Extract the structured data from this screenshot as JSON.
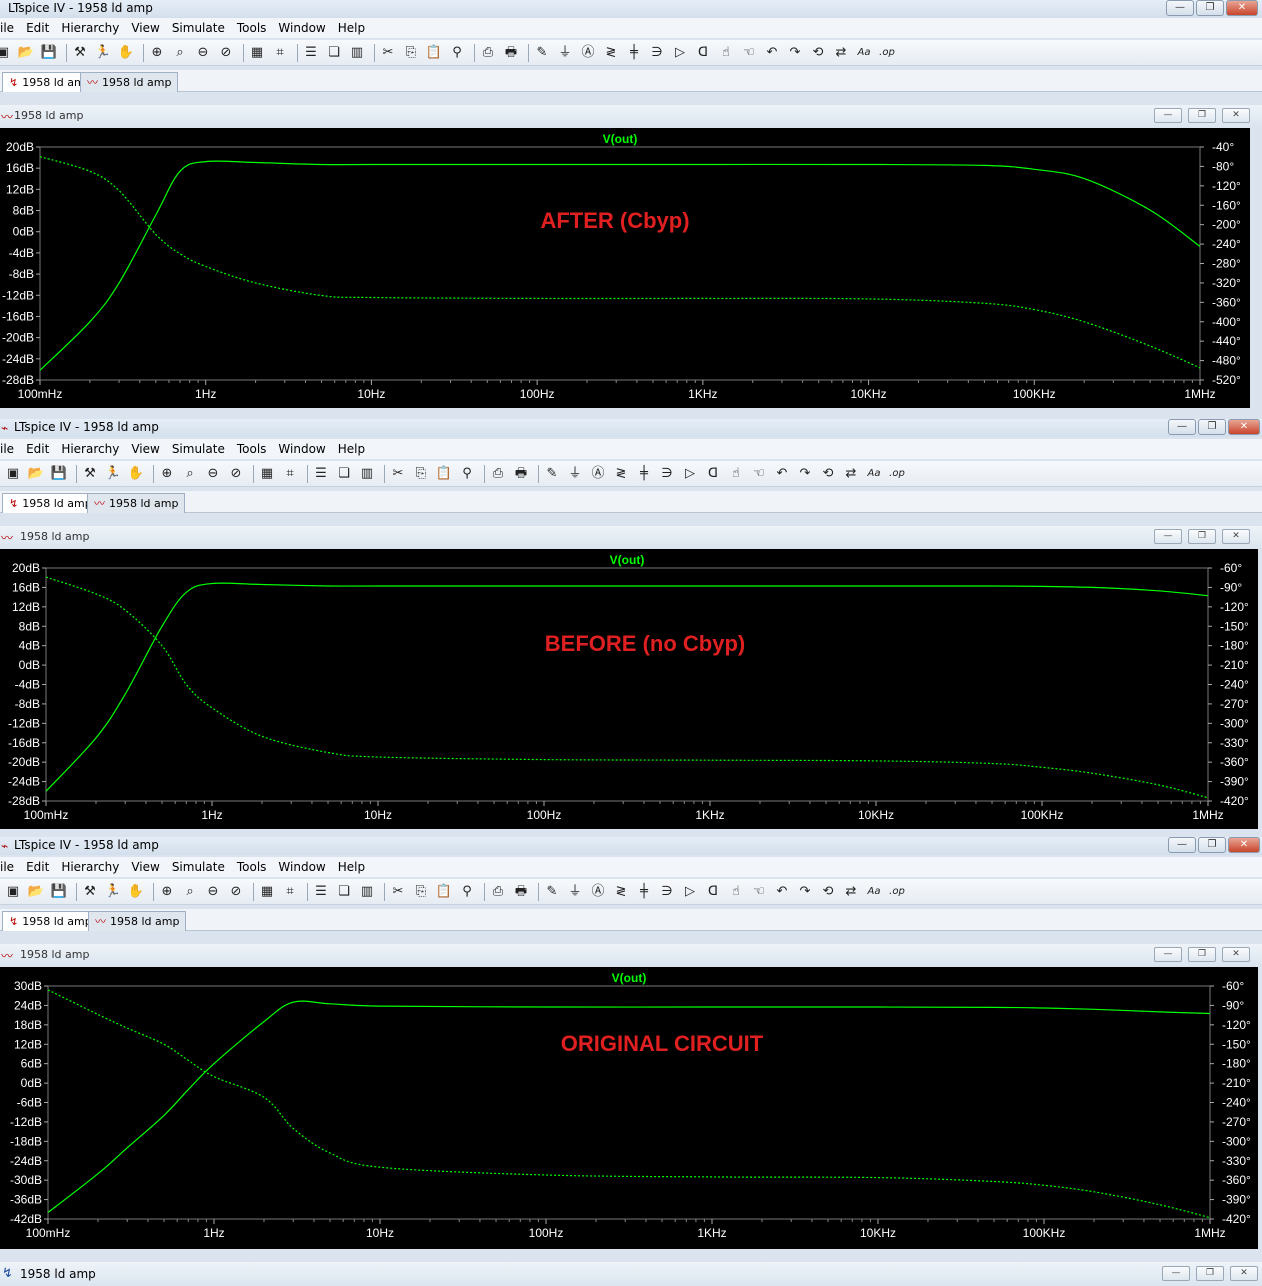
{
  "app_title": "LTspice IV - 1958 ld amp",
  "menu": [
    "ile",
    "Edit",
    "Hierarchy",
    "View",
    "Simulate",
    "Tools",
    "Window",
    "Help"
  ],
  "tabs": [
    {
      "label": "1958 ld amp"
    },
    {
      "label": "1958 ld amp"
    }
  ],
  "window_title": "1958 ld amp",
  "trace_name": "V(out)",
  "x_ticks": [
    "100mHz",
    "1Hz",
    "10Hz",
    "100Hz",
    "1KHz",
    "10KHz",
    "100KHz",
    "1MHz"
  ],
  "colors": {
    "trace": "#00ff00",
    "annotation": "#e02020",
    "axis_text": "#ffffff",
    "plot_bg": "#000000"
  },
  "bottom_title": "1958 ld amp",
  "toolbar_icons": [
    "new-schematic-icon",
    "open-icon",
    "save-icon",
    "hammer-icon",
    "run-icon",
    "hand-icon",
    "zoom-in-icon",
    "zoom-area-icon",
    "zoom-out-icon",
    "zoom-cancel-icon",
    "autorange-icon",
    "grid-icon",
    "tile-h-icon",
    "cascade-icon",
    "tile-v-icon",
    "cut-icon",
    "copy-icon",
    "paste-icon",
    "find-icon",
    "print-setup-icon",
    "print-icon",
    "wire-icon",
    "ground-icon",
    "label-icon",
    "resistor-icon",
    "capacitor-icon",
    "inductor-icon",
    "diode-icon",
    "component-icon",
    "move-icon",
    "drag-icon",
    "undo-icon",
    "redo-icon",
    "rotate-icon",
    "mirror-icon",
    "text-icon",
    "spice-directive-icon"
  ],
  "chart_data": [
    {
      "type": "line",
      "annotation": "AFTER  (Cbyp)",
      "x_axis": "log frequency",
      "x": [
        "100mHz",
        "200mHz",
        "300mHz",
        "500mHz",
        "700mHz",
        "1Hz",
        "2Hz",
        "5Hz",
        "10Hz",
        "100Hz",
        "1KHz",
        "10KHz",
        "50KHz",
        "100KHz",
        "200KHz",
        "500KHz",
        "1MHz"
      ],
      "yleft_ticks": [
        "20dB",
        "16dB",
        "12dB",
        "8dB",
        "0dB",
        "-4dB",
        "-8dB",
        "-12dB",
        "-16dB",
        "-20dB",
        "-24dB",
        "-28dB"
      ],
      "yright_ticks": [
        "-40°",
        "-80°",
        "-120°",
        "-160°",
        "-200°",
        "-240°",
        "-280°",
        "-320°",
        "-360°",
        "-400°",
        "-440°",
        "-480°",
        "-520°"
      ],
      "ylim_left": [
        -28,
        20
      ],
      "ylim_right": [
        -520,
        -40
      ],
      "series": [
        {
          "values": [
            -26,
            -16,
            -8,
            6,
            15,
            17,
            16.8,
            16.4,
            16.4,
            16.4,
            16.4,
            16.4,
            16.2,
            15.4,
            13.5,
            7,
            -0.5
          ],
          "style": "solid"
        },
        {
          "values": [
            -60,
            -90,
            -130,
            -220,
            -260,
            -286,
            -320,
            -346,
            -350,
            -352,
            -352,
            -353,
            -362,
            -375,
            -400,
            -450,
            -495
          ],
          "style": "dotted"
        }
      ]
    },
    {
      "type": "line",
      "annotation": "BEFORE (no Cbyp)",
      "x_axis": "log frequency",
      "x": [
        "100mHz",
        "200mHz",
        "300mHz",
        "500mHz",
        "700mHz",
        "1Hz",
        "2Hz",
        "5Hz",
        "10Hz",
        "100Hz",
        "1KHz",
        "10KHz",
        "50KHz",
        "100KHz",
        "200KHz",
        "500KHz",
        "1MHz"
      ],
      "yleft_ticks": [
        "20dB",
        "16dB",
        "12dB",
        "8dB",
        "4dB",
        "0dB",
        "-4dB",
        "-8dB",
        "-12dB",
        "-16dB",
        "-20dB",
        "-24dB",
        "-28dB"
      ],
      "yright_ticks": [
        "-60°",
        "-90°",
        "-120°",
        "-150°",
        "-180°",
        "-210°",
        "-240°",
        "-270°",
        "-300°",
        "-330°",
        "-360°",
        "-390°",
        "-420°"
      ],
      "ylim_left": [
        -28,
        20
      ],
      "ylim_right": [
        -420,
        -60
      ],
      "series": [
        {
          "values": [
            -26,
            -15,
            -6,
            8,
            15,
            16.8,
            16.6,
            16.3,
            16.3,
            16.3,
            16.3,
            16.3,
            16.3,
            16.2,
            16.0,
            15.3,
            14.3
          ],
          "style": "solid"
        },
        {
          "values": [
            -74,
            -100,
            -125,
            -180,
            -240,
            -276,
            -320,
            -345,
            -352,
            -356,
            -357,
            -358,
            -362,
            -368,
            -377,
            -395,
            -415
          ],
          "style": "dotted"
        }
      ]
    },
    {
      "type": "line",
      "annotation": "ORIGINAL CIRCUIT",
      "x_axis": "log frequency",
      "x": [
        "100mHz",
        "200mHz",
        "300mHz",
        "500mHz",
        "700mHz",
        "1Hz",
        "2Hz",
        "3Hz",
        "5Hz",
        "10Hz",
        "100Hz",
        "1KHz",
        "10KHz",
        "50KHz",
        "100KHz",
        "200KHz",
        "500KHz",
        "1MHz"
      ],
      "yleft_ticks": [
        "30dB",
        "24dB",
        "18dB",
        "12dB",
        "6dB",
        "0dB",
        "-6dB",
        "-12dB",
        "-18dB",
        "-24dB",
        "-30dB",
        "-36dB",
        "-42dB"
      ],
      "yright_ticks": [
        "-60°",
        "-90°",
        "-120°",
        "-150°",
        "-180°",
        "-210°",
        "-240°",
        "-270°",
        "-300°",
        "-330°",
        "-360°",
        "-390°",
        "-420°"
      ],
      "ylim_left": [
        -42,
        30
      ],
      "ylim_right": [
        -420,
        -60
      ],
      "series": [
        {
          "values": [
            -40,
            -28,
            -20,
            -10,
            -2,
            6,
            19,
            25,
            24.5,
            23.8,
            23.5,
            23.5,
            23.5,
            23.4,
            23.2,
            22.8,
            22,
            21.5
          ],
          "style": "solid"
        },
        {
          "values": [
            -66,
            -104,
            -125,
            -150,
            -175,
            -200,
            -232,
            -280,
            -318,
            -340,
            -352,
            -355,
            -356,
            -362,
            -368,
            -378,
            -398,
            -418
          ],
          "style": "dotted"
        }
      ]
    }
  ]
}
